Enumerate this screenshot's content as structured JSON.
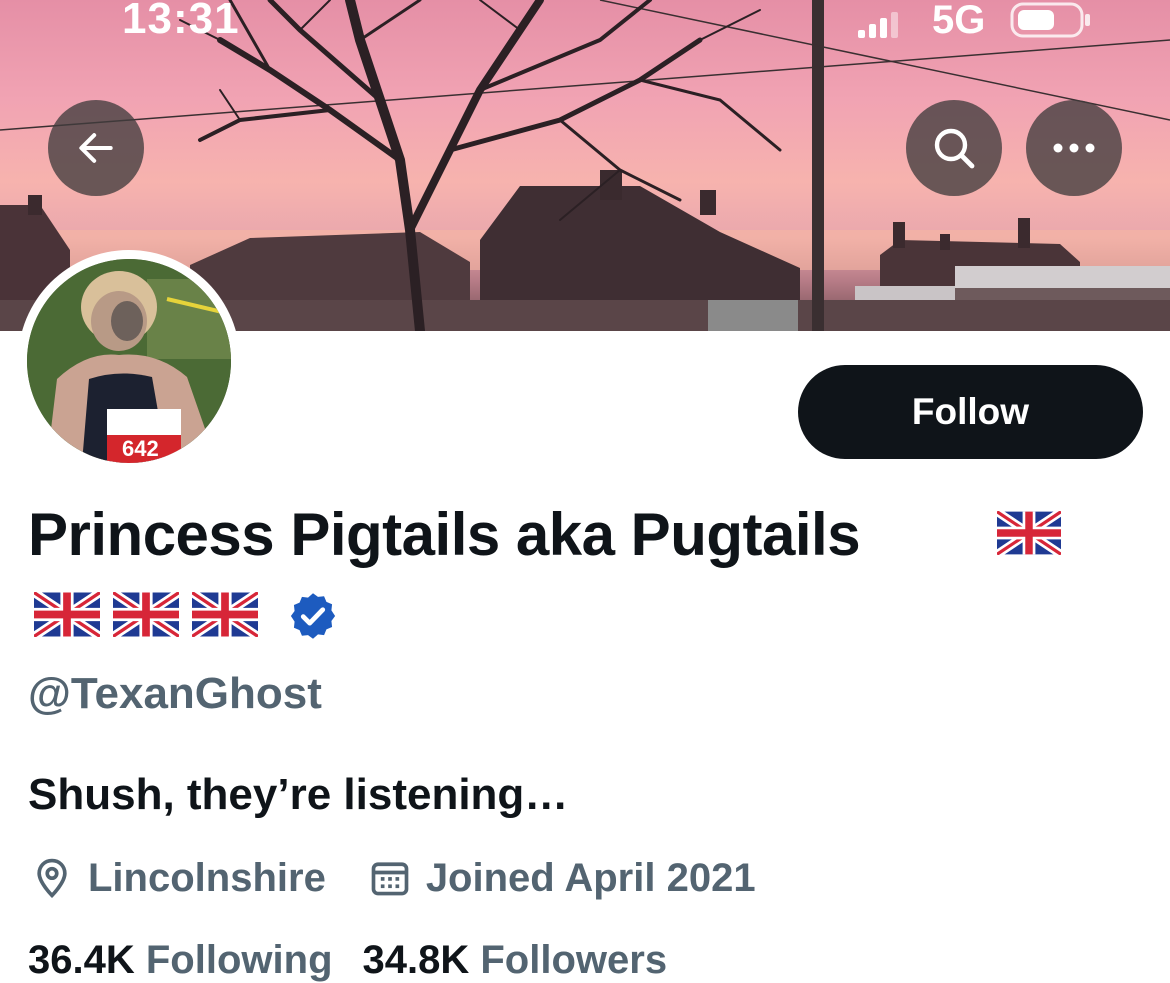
{
  "status_bar": {
    "time": "13:31",
    "network": "5G"
  },
  "header": {
    "back_icon": "arrow-left-icon",
    "search_icon": "search-icon",
    "more_icon": "more-horizontal-icon"
  },
  "profile": {
    "avatar_bib_number": "642",
    "follow_label": "Follow",
    "display_name": "Princess Pigtails aka Pugtails",
    "handle": "@TexanGhost",
    "verified_icon": "verified-badge-icon",
    "flag_icon": "uk-flag-icon",
    "bio": "Shush, they’re listening…",
    "location": "Lincolnshire",
    "joined": "Joined April 2021",
    "following_count": "36.4K",
    "following_label": "Following",
    "followers_count": "34.8K",
    "followers_label": "Followers"
  },
  "colors": {
    "text_primary": "#0f1419",
    "text_secondary": "#536471",
    "verified_blue": "#1d5bbf",
    "button_dark": "#0f1419"
  }
}
